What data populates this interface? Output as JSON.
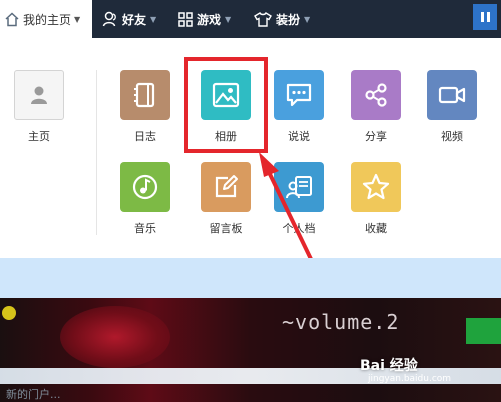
{
  "nav": {
    "home": "我的主页",
    "friends": "好友",
    "games": "游戏",
    "dressup": "装扮"
  },
  "home_tile": {
    "label": "主页"
  },
  "apps": [
    {
      "key": "diary",
      "label": "日志",
      "color": "#b78c6c",
      "icon": "notebook-icon"
    },
    {
      "key": "album",
      "label": "相册",
      "color": "#2fbcc3",
      "icon": "photo-icon"
    },
    {
      "key": "shuoshuo",
      "label": "说说",
      "color": "#4aa0de",
      "icon": "chat-bubble-icon"
    },
    {
      "key": "share",
      "label": "分享",
      "color": "#a97bc7",
      "icon": "share-icon"
    },
    {
      "key": "video",
      "label": "视频",
      "color": "#6387c0",
      "icon": "video-camera-icon"
    },
    {
      "key": "music",
      "label": "音乐",
      "color": "#7dba45",
      "icon": "music-note-icon"
    },
    {
      "key": "guestbook",
      "label": "留言板",
      "color": "#d99b5f",
      "icon": "edit-icon"
    },
    {
      "key": "profile",
      "label": "个人档",
      "color": "#3d9ad1",
      "icon": "profile-card-icon"
    },
    {
      "key": "favorites",
      "label": "收藏",
      "color": "#f0c85a",
      "icon": "star-icon"
    }
  ],
  "highlight_color": "#e4262c",
  "banner": {
    "title": "~volume.2",
    "footer": "新的门户..."
  },
  "watermark": {
    "main": "Bai 经验",
    "sub": "jingyan.baidu.com"
  }
}
